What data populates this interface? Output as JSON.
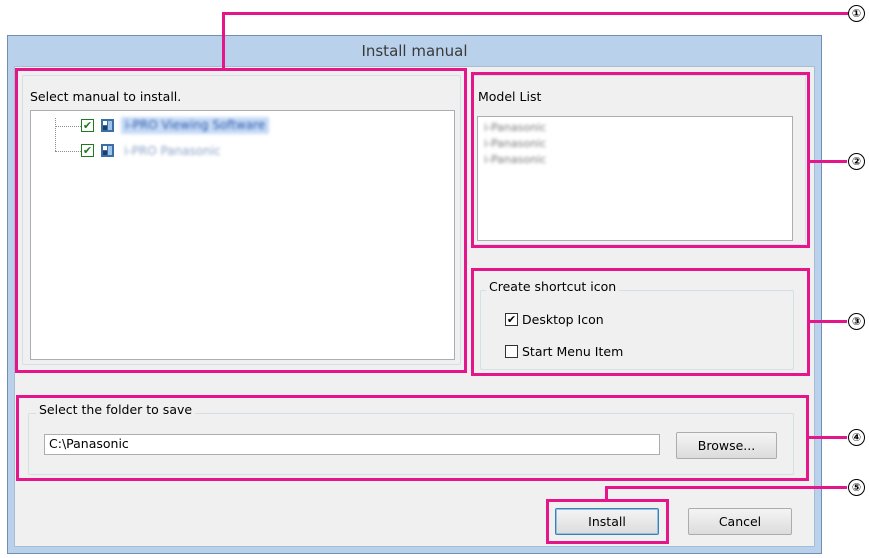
{
  "window": {
    "title": "Install manual"
  },
  "manual_panel": {
    "label": "Select manual to install.",
    "items": [
      {
        "label": "i-PRO Viewing Software",
        "checked": true
      },
      {
        "label": "i-PRO Panasonic",
        "checked": true
      }
    ]
  },
  "model_panel": {
    "label": "Model List",
    "items": [
      "i-Panasonic",
      "i-Panasonic",
      "i-Panasonic"
    ]
  },
  "shortcut_panel": {
    "label": "Create shortcut icon",
    "desktop_icon": {
      "label": "Desktop Icon",
      "checked": true
    },
    "start_menu": {
      "label": "Start Menu Item",
      "checked": false
    }
  },
  "folder_panel": {
    "label": "Select the folder to save",
    "path": "C:\\Panasonic",
    "browse_label": "Browse..."
  },
  "buttons": {
    "install": "Install",
    "cancel": "Cancel"
  },
  "callouts": [
    "①",
    "②",
    "③",
    "④",
    "⑤"
  ],
  "colors": {
    "annotation": "#e4168a",
    "window_frame": "#b9d1ea",
    "dialog_bg": "#f0f0f0"
  }
}
